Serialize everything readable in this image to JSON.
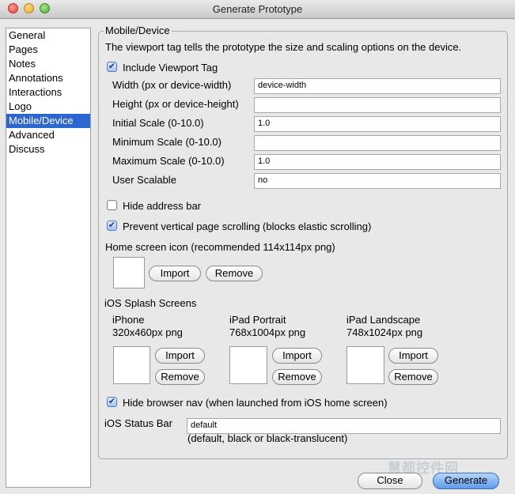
{
  "window": {
    "title": "Generate Prototype"
  },
  "sidebar": {
    "items": [
      {
        "label": "General"
      },
      {
        "label": "Pages"
      },
      {
        "label": "Notes"
      },
      {
        "label": "Annotations"
      },
      {
        "label": "Interactions"
      },
      {
        "label": "Logo"
      },
      {
        "label": "Mobile/Device",
        "selected": true
      },
      {
        "label": "Advanced"
      },
      {
        "label": "Discuss"
      }
    ]
  },
  "panel": {
    "title": "Mobile/Device",
    "description": "The viewport tag tells the prototype the size and scaling options on the device.",
    "include_viewport": {
      "label": "Include Viewport Tag",
      "checked": true
    },
    "fields": {
      "width": {
        "label": "Width (px or device-width)",
        "value": "device-width"
      },
      "height": {
        "label": "Height (px or device-height)",
        "value": ""
      },
      "initial_scale": {
        "label": "Initial Scale (0-10.0)",
        "value": "1.0"
      },
      "minimum_scale": {
        "label": "Minimum Scale (0-10.0)",
        "value": ""
      },
      "maximum_scale": {
        "label": "Maximum Scale (0-10.0)",
        "value": "1.0"
      },
      "user_scalable": {
        "label": "User Scalable",
        "value": "no"
      }
    },
    "hide_address_bar": {
      "label": "Hide address bar",
      "checked": false
    },
    "prevent_scrolling": {
      "label": "Prevent vertical page scrolling (blocks elastic scrolling)",
      "checked": true
    },
    "home_icon": {
      "label": "Home screen icon (recommended 114x114px png)",
      "import_label": "Import",
      "remove_label": "Remove"
    },
    "splash": {
      "label": "iOS Splash Screens",
      "iphone": {
        "title": "iPhone",
        "size": "320x460px png",
        "import_label": "Import",
        "remove_label": "Remove"
      },
      "ipad_portrait": {
        "title": "iPad Portrait",
        "size": "768x1004px png",
        "import_label": "Import",
        "remove_label": "Remove"
      },
      "ipad_landscape": {
        "title": "iPad Landscape",
        "size": "748x1024px png",
        "import_label": "Import",
        "remove_label": "Remove"
      }
    },
    "hide_browser_nav": {
      "label": "Hide browser nav (when launched from iOS home screen)",
      "checked": true
    },
    "status_bar": {
      "label": "iOS Status Bar",
      "value": "default",
      "hint": "(default, black or black-translucent)"
    }
  },
  "footer": {
    "close_label": "Close",
    "generate_label": "Generate"
  },
  "watermark": "慧都控件网"
}
